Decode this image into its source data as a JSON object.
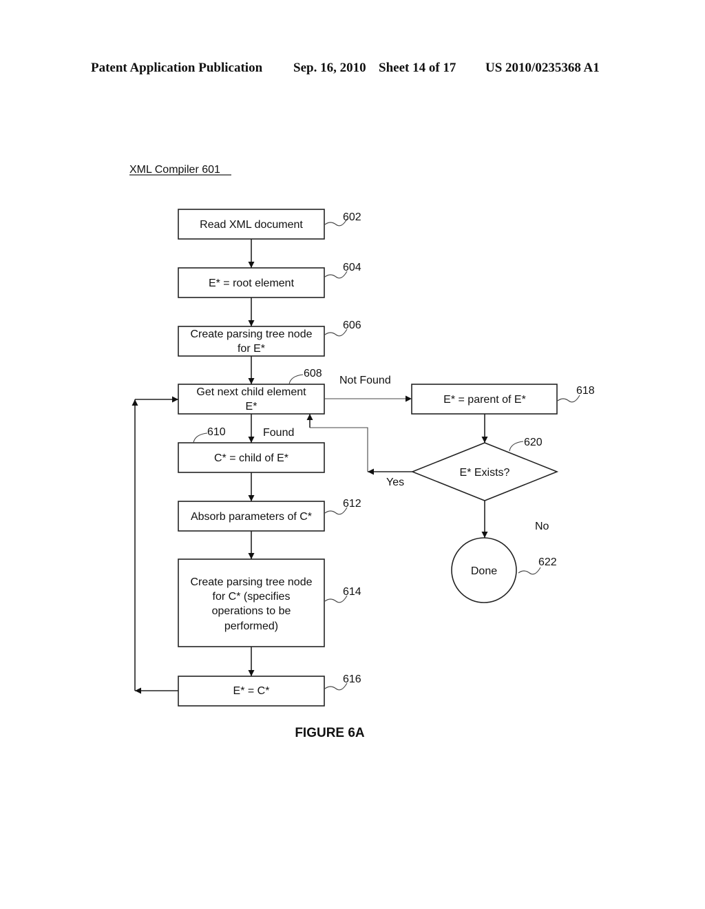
{
  "header": {
    "left": "Patent Application Publication",
    "date": "Sep. 16, 2010",
    "sheet": "Sheet 14 of 17",
    "number": "US 2010/0235368 A1"
  },
  "diagram": {
    "title": "XML Compiler 601",
    "figure_label": "FIGURE 6A",
    "nodes": {
      "n602": {
        "ref": "602",
        "lines": [
          "Read XML document"
        ]
      },
      "n604": {
        "ref": "604",
        "lines": [
          "E* = root element"
        ]
      },
      "n606": {
        "ref": "606",
        "lines": [
          "Create parsing tree node",
          "for E*"
        ]
      },
      "n608": {
        "ref": "608",
        "lines": [
          "Get next child element",
          "E*"
        ]
      },
      "n610": {
        "ref": "610",
        "lines": [
          "C* = child of E*"
        ]
      },
      "n612": {
        "ref": "612",
        "lines": [
          "Absorb parameters of C*"
        ]
      },
      "n614": {
        "ref": "614",
        "lines": [
          "Create parsing tree node",
          "for C* (specifies",
          "operations to be",
          "performed)"
        ]
      },
      "n616": {
        "ref": "616",
        "lines": [
          "E* = C*"
        ]
      },
      "n618": {
        "ref": "618",
        "lines": [
          "E* = parent of E*"
        ]
      },
      "n620": {
        "ref": "620",
        "lines": [
          "E* Exists?"
        ]
      },
      "n622": {
        "ref": "622",
        "lines": [
          "Done"
        ]
      }
    },
    "edge_labels": {
      "not_found": "Not Found",
      "found": "Found",
      "yes": "Yes",
      "no": "No"
    }
  }
}
